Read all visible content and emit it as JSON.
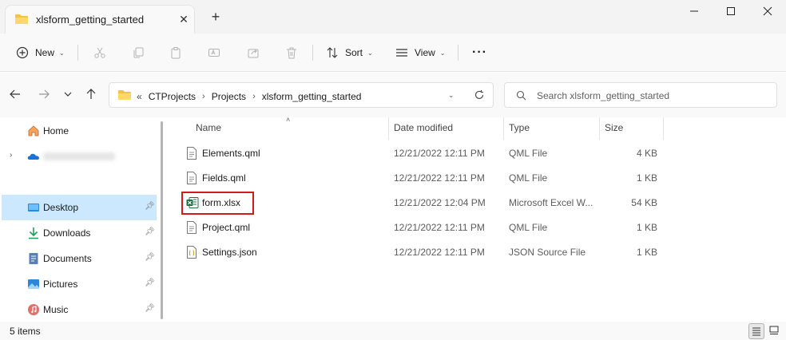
{
  "window": {
    "tab_title": "xlsform_getting_started",
    "tab_close": "✕",
    "new_tab": "+"
  },
  "toolbar": {
    "new_label": "New",
    "sort_label": "Sort",
    "view_label": "View",
    "more_label": "···"
  },
  "address": {
    "overflow": "«",
    "crumbs": [
      "CTProjects",
      "Projects",
      "xlsform_getting_started"
    ],
    "search_placeholder": "Search xlsform_getting_started"
  },
  "sidebar": {
    "items": [
      {
        "label": "Home",
        "icon": "home-icon"
      },
      {
        "label": "",
        "icon": "onedrive-icon"
      },
      {
        "label": "Desktop",
        "icon": "desktop-icon"
      },
      {
        "label": "Downloads",
        "icon": "download-icon"
      },
      {
        "label": "Documents",
        "icon": "documents-icon"
      },
      {
        "label": "Pictures",
        "icon": "pictures-icon"
      },
      {
        "label": "Music",
        "icon": "music-icon"
      }
    ]
  },
  "columns": {
    "name": "Name",
    "date": "Date modified",
    "type": "Type",
    "size": "Size"
  },
  "files": [
    {
      "name": "Elements.qml",
      "date": "12/21/2022 12:11 PM",
      "type": "QML File",
      "size": "4 KB"
    },
    {
      "name": "Fields.qml",
      "date": "12/21/2022 12:11 PM",
      "type": "QML File",
      "size": "1 KB"
    },
    {
      "name": "form.xlsx",
      "date": "12/21/2022 12:04 PM",
      "type": "Microsoft Excel W...",
      "size": "54 KB"
    },
    {
      "name": "Project.qml",
      "date": "12/21/2022 12:11 PM",
      "type": "QML File",
      "size": "1 KB"
    },
    {
      "name": "Settings.json",
      "date": "12/21/2022 12:11 PM",
      "type": "JSON Source File",
      "size": "1 KB"
    }
  ],
  "status": {
    "item_count": "5 items"
  },
  "colors": {
    "selected": "#cce8ff",
    "highlight_border": "#d11b1b",
    "folder": "#f4c245",
    "excel": "#1d6f42"
  }
}
